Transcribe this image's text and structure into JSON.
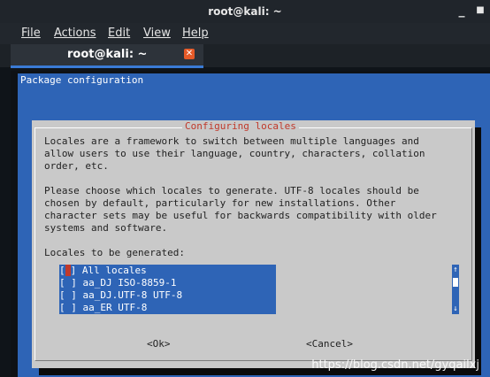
{
  "window": {
    "title": "root@kali: ~",
    "minimize": "_",
    "close": "■"
  },
  "menu": [
    {
      "label": "File"
    },
    {
      "label": "Actions"
    },
    {
      "label": "Edit"
    },
    {
      "label": "View"
    },
    {
      "label": "Help"
    }
  ],
  "tab": {
    "label": "root@kali: ~",
    "close": "✕"
  },
  "terminal": {
    "header": "Package configuration",
    "dialog": {
      "title": "Configuring locales",
      "paragraph1": [
        "Locales are a framework to switch between multiple languages and",
        "allow users to use their language, country, characters, collation",
        "order, etc."
      ],
      "paragraph2": [
        "Please choose which locales to generate. UTF-8 locales should be",
        "chosen by default, particularly for new installations. Other",
        "character sets may be useful for backwards compatibility with older",
        "systems and software."
      ],
      "list_label": "Locales to be generated:",
      "items": [
        {
          "text": "All locales",
          "checked": false,
          "focused": true
        },
        {
          "text": "aa_DJ ISO-8859-1",
          "checked": false
        },
        {
          "text": "aa_DJ.UTF-8 UTF-8",
          "checked": false
        },
        {
          "text": "aa_ER UTF-8",
          "checked": false
        }
      ],
      "scroll_up": "↑",
      "scroll_down": "↓",
      "ok_label": "<Ok>",
      "cancel_label": "<Cancel>"
    }
  },
  "watermark": "https://blog.csdn.net/gyqailxj",
  "colors": {
    "accent": "#2e64b6",
    "dialog_bg": "#c9c9c9",
    "title_red": "#c0392b",
    "tab_close": "#e55a28"
  }
}
